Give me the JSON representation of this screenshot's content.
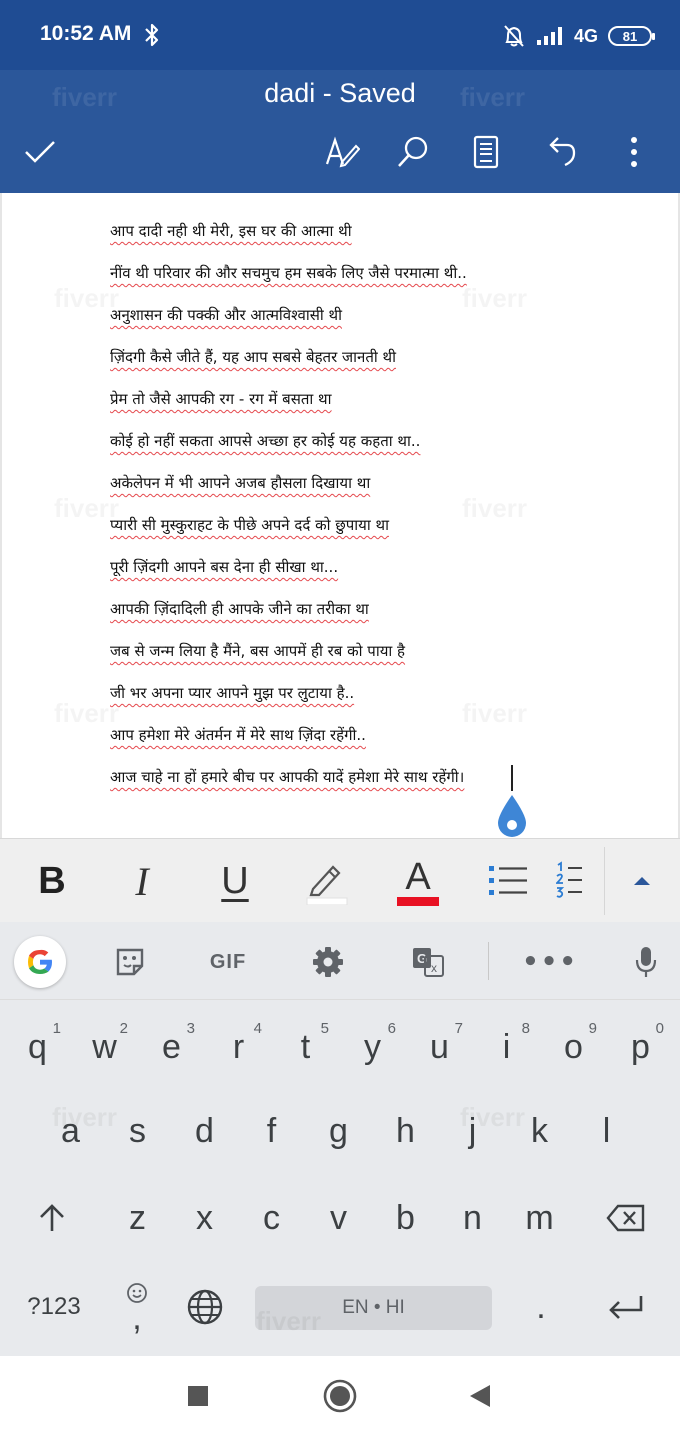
{
  "status_bar": {
    "time": "10:52 AM",
    "network": "4G",
    "battery": "81",
    "icons": [
      "bluetooth-icon",
      "mute-bell-icon",
      "signal-icon",
      "battery-icon"
    ]
  },
  "app_bar": {
    "title": "dadi - Saved",
    "watermark": "fiverr",
    "toolbar_icons": [
      "check-icon",
      "pen-format-icon",
      "search-icon",
      "read-mode-icon",
      "undo-icon",
      "more-vert-icon"
    ]
  },
  "document": {
    "lines": [
      "आप दादी नही थी मेरी, इस घर की आत्मा थी",
      "नींव थी परिवार की और सचमुच हम सबके लिए जैसे परमात्मा थी..",
      "अनुशासन की पक्की और आत्मविश्वासी थी",
      "ज़िंदगी कैसे जीते हैं, यह आप सबसे बेहतर जानती थी",
      "प्रेम तो जैसे आपकी रग - रग में बसता था",
      "कोई हो नहीं सकता आपसे अच्छा हर कोई यह कहता था..",
      "अकेलेपन में भी आपने अजब हौसला दिखाया था",
      "प्यारी सी मुस्कुराहट के पीछे अपने दर्द को छुपाया था",
      "पूरी ज़िंदगी आपने बस देना ही सीखा था...",
      "आपकी ज़िंदादिली ही आपके जीने का तरीका था",
      "जब से जन्म लिया है मैंने, बस आपमें ही रब को पाया है",
      "जी भर अपना प्यार आपने मुझ पर लुटाया है..",
      "आप हमेशा मेरे अंतर्मन में मेरे साथ ज़िंदा रहेंगी..",
      "आज चाहे ना हों हमारे बीच पर आपकी यादें हमेशा मेरे साथ रहेंगी।"
    ]
  },
  "format_bar": {
    "bold": "B",
    "italic": "I",
    "underline": "U",
    "font_color": "A",
    "highlight_color": "#ffffff",
    "font_color_value": "#e81123",
    "accent": "#2b579a"
  },
  "keyboard": {
    "suggestion_icons": [
      "google-icon",
      "sticker-icon",
      "gif-button",
      "settings-gear-icon",
      "translate-icon",
      "more-dots-icon",
      "mic-icon"
    ],
    "gif_label": "GIF",
    "more_label": "•••",
    "row1": [
      {
        "k": "q",
        "n": "1"
      },
      {
        "k": "w",
        "n": "2"
      },
      {
        "k": "e",
        "n": "3"
      },
      {
        "k": "r",
        "n": "4"
      },
      {
        "k": "t",
        "n": "5"
      },
      {
        "k": "y",
        "n": "6"
      },
      {
        "k": "u",
        "n": "7"
      },
      {
        "k": "i",
        "n": "8"
      },
      {
        "k": "o",
        "n": "9"
      },
      {
        "k": "p",
        "n": "0"
      }
    ],
    "row2": [
      "a",
      "s",
      "d",
      "f",
      "g",
      "h",
      "j",
      "k",
      "l"
    ],
    "row3": [
      "z",
      "x",
      "c",
      "v",
      "b",
      "n",
      "m"
    ],
    "symbols_key": "?123",
    "comma_key": ",",
    "period_key": ".",
    "space_label": "EN • HI"
  }
}
